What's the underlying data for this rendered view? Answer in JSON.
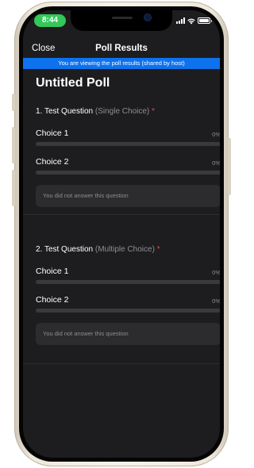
{
  "status_bar": {
    "time": "8:44"
  },
  "nav": {
    "close_label": "Close",
    "title": "Poll Results"
  },
  "banner": {
    "text": "You are viewing the poll results (shared by host)"
  },
  "poll": {
    "title": "Untitled Poll",
    "questions": [
      {
        "number_title": "1. Test Question",
        "type": "(Single Choice)",
        "required_mark": "*",
        "choices": [
          {
            "label": "Choice 1",
            "percent_text": "0%",
            "percent": 0
          },
          {
            "label": "Choice 2",
            "percent_text": "0%",
            "percent": 0
          }
        ],
        "note": "You did not answer this question"
      },
      {
        "number_title": "2. Test Question",
        "type": "(Multiple Choice)",
        "required_mark": "*",
        "choices": [
          {
            "label": "Choice 1",
            "percent_text": "0%",
            "percent": 0
          },
          {
            "label": "Choice 2",
            "percent_text": "0%",
            "percent": 0
          }
        ],
        "note": "You did not answer this question"
      }
    ]
  },
  "colors": {
    "accent": "#0e72ed",
    "status_time_bg": "#34c759",
    "required": "#e5484d",
    "background": "#1d1d1f"
  },
  "icons": [
    "signal-icon",
    "wifi-icon",
    "battery-icon",
    "front-camera-icon"
  ]
}
